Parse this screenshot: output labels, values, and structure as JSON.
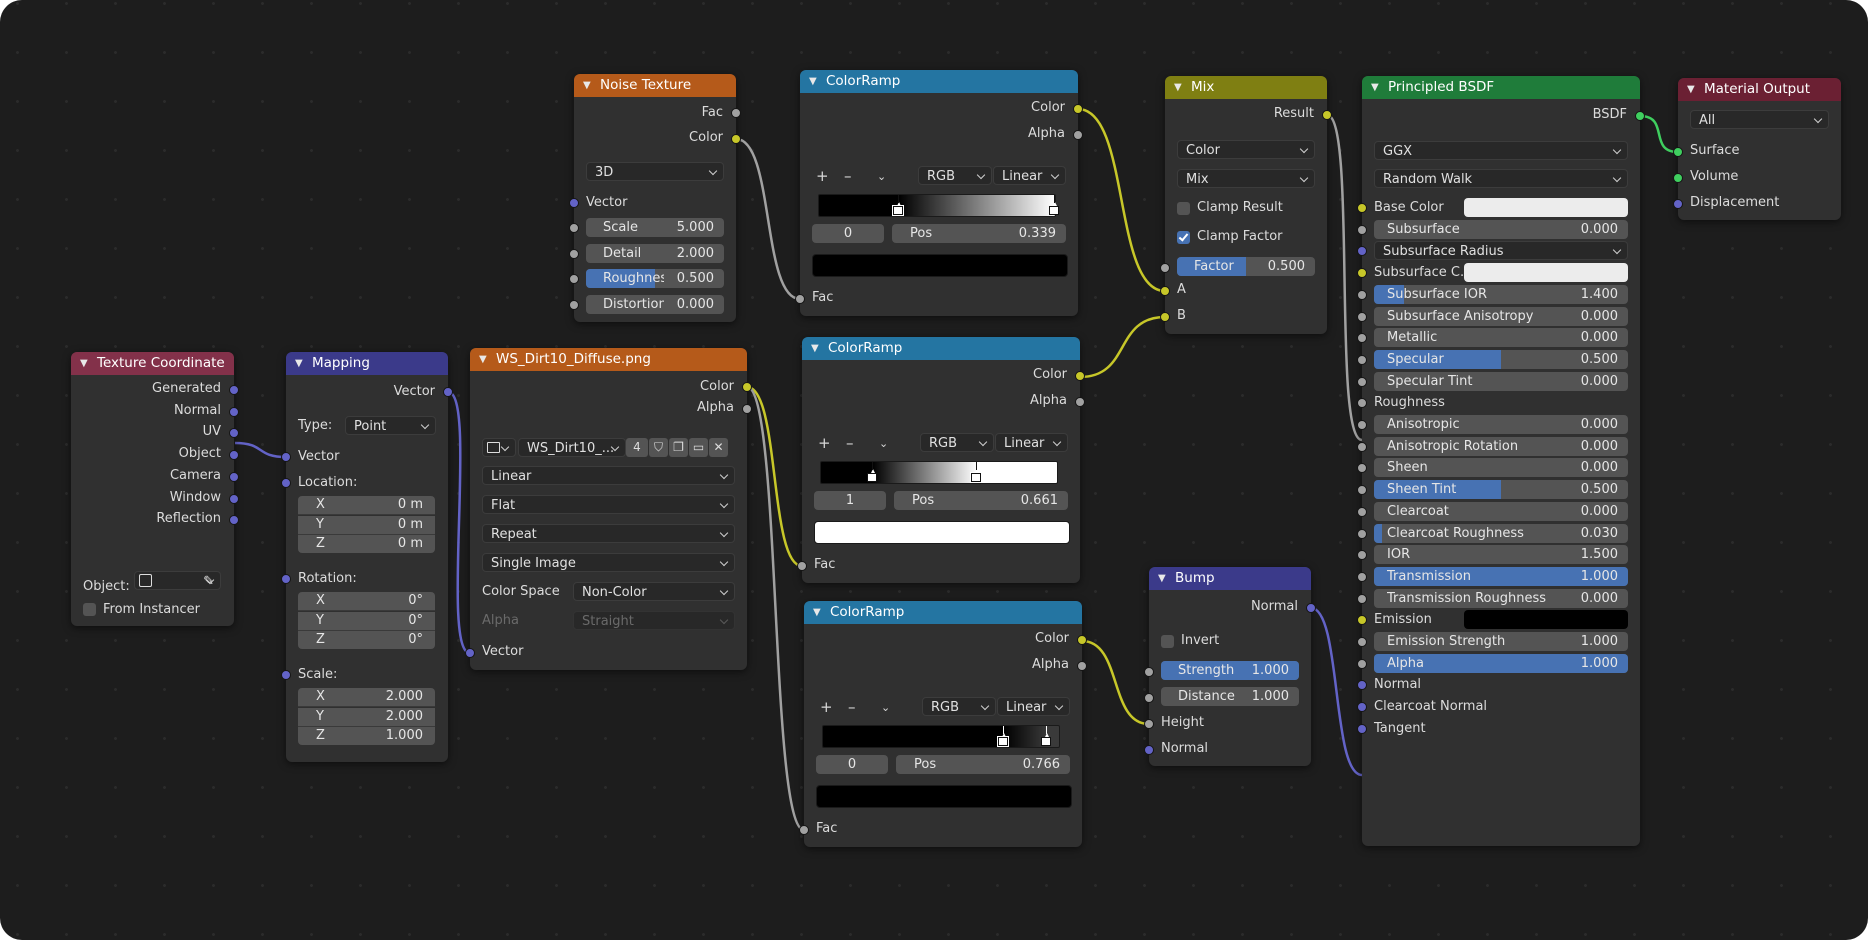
{
  "colors": {
    "bg": "#1d1d1d",
    "node": "#303030",
    "accent": "#4772b3",
    "socket_color": "#c7c729",
    "socket_float": "#a1a1a1",
    "socket_vector": "#6363c7",
    "socket_shader": "#3fcf5f"
  },
  "tex_coord": {
    "title": "Texture Coordinate",
    "outputs": [
      "Generated",
      "Normal",
      "UV",
      "Object",
      "Camera",
      "Window",
      "Reflection"
    ],
    "object_label": "Object:",
    "from_instancer": "From Instancer"
  },
  "mapping": {
    "title": "Mapping",
    "out_vector": "Vector",
    "type_label": "Type:",
    "type_value": "Point",
    "in_vector": "Vector",
    "location": "Location:",
    "rotation": "Rotation:",
    "scale": "Scale:",
    "loc": [
      {
        "axis": "X",
        "value": "0 m"
      },
      {
        "axis": "Y",
        "value": "0 m"
      },
      {
        "axis": "Z",
        "value": "0 m"
      }
    ],
    "rot": [
      {
        "axis": "X",
        "value": "0°"
      },
      {
        "axis": "Y",
        "value": "0°"
      },
      {
        "axis": "Z",
        "value": "0°"
      }
    ],
    "scl": [
      {
        "axis": "X",
        "value": "2.000"
      },
      {
        "axis": "Y",
        "value": "2.000"
      },
      {
        "axis": "Z",
        "value": "1.000"
      }
    ]
  },
  "image_tex": {
    "title": "WS_Dirt10_Diffuse.png",
    "out_color": "Color",
    "out_alpha": "Alpha",
    "image_name": "WS_Dirt10_...",
    "users": "4",
    "interpolation": "Linear",
    "projection": "Flat",
    "extension": "Repeat",
    "source": "Single Image",
    "color_space_label": "Color Space",
    "color_space": "Non-Color",
    "alpha_label": "Alpha",
    "alpha_mode": "Straight",
    "in_vector": "Vector"
  },
  "noise": {
    "title": "Noise Texture",
    "out_fac": "Fac",
    "out_color": "Color",
    "dimensions": "3D",
    "in_vector": "Vector",
    "fields": [
      {
        "label": "Scale",
        "value": "5.000"
      },
      {
        "label": "Detail",
        "value": "2.000"
      },
      {
        "label": "Roughnes",
        "value": "0.500",
        "fill": 0.5
      },
      {
        "label": "Distortion",
        "value": "0.000"
      }
    ]
  },
  "ramps": [
    {
      "title": "ColorRamp",
      "out_color": "Color",
      "out_alpha": "Alpha",
      "mode": "RGB",
      "interp": "Linear",
      "index": "0",
      "pos_label": "Pos",
      "pos": "0.339",
      "stops": [
        0.339,
        1.0
      ],
      "gradient": [
        "#000000",
        "#000000",
        "#ffffff"
      ],
      "swatch": "#000000",
      "in_fac": "Fac"
    },
    {
      "title": "ColorRamp",
      "out_color": "Color",
      "out_alpha": "Alpha",
      "mode": "RGB",
      "interp": "Linear",
      "index": "1",
      "pos_label": "Pos",
      "pos": "0.661",
      "stops": [
        0.219,
        0.661
      ],
      "gradient": [
        "#000000",
        "#000000",
        "#ffffff",
        "#ffffff"
      ],
      "swatch": "#ffffff",
      "in_fac": "Fac"
    },
    {
      "title": "ColorRamp",
      "out_color": "Color",
      "out_alpha": "Alpha",
      "mode": "RGB",
      "interp": "Linear",
      "index": "0",
      "pos_label": "Pos",
      "pos": "0.766",
      "stops": [
        0.766,
        0.95
      ],
      "gradient": [
        "#000000",
        "#000000",
        "#3a3a3a"
      ],
      "swatch": "#000000",
      "in_fac": "Fac"
    }
  ],
  "mix": {
    "title": "Mix",
    "out_result": "Result",
    "data_type": "Color",
    "blend": "Mix",
    "clamp_result": "Clamp Result",
    "clamp_factor": "Clamp Factor",
    "factor_label": "Factor",
    "factor_value": "0.500",
    "factor": 0.5,
    "in_a": "A",
    "in_b": "B"
  },
  "bump": {
    "title": "Bump",
    "out_normal": "Normal",
    "invert": "Invert",
    "strength_label": "Strength",
    "strength": "1.000",
    "distance_label": "Distance",
    "distance": "1.000",
    "in_height": "Height",
    "in_normal": "Normal"
  },
  "bsdf": {
    "title": "Principled BSDF",
    "out": "BSDF",
    "distribution": "GGX",
    "subsurface_method": "Random Walk",
    "base_color": "Base Color",
    "subsurface_color": "Subsurface C...",
    "subsurface_radius": "Subsurface Radius",
    "roughness": "Roughness",
    "emission": "Emission",
    "normal": "Normal",
    "clearcoat_normal": "Clearcoat Normal",
    "tangent": "Tangent",
    "fields": [
      {
        "label": "Subsurface",
        "value": "0.000",
        "fill": 0
      },
      {
        "label": "Subsurface IOR",
        "value": "1.400",
        "fill": 0.12
      },
      {
        "label": "Subsurface Anisotropy",
        "value": "0.000",
        "fill": 0
      },
      {
        "label": "Metallic",
        "value": "0.000",
        "fill": 0
      },
      {
        "label": "Specular",
        "value": "0.500",
        "fill": 0.5
      },
      {
        "label": "Specular Tint",
        "value": "0.000",
        "fill": 0
      },
      {
        "label": "Anisotropic",
        "value": "0.000",
        "fill": 0
      },
      {
        "label": "Anisotropic Rotation",
        "value": "0.000",
        "fill": 0
      },
      {
        "label": "Sheen",
        "value": "0.000",
        "fill": 0
      },
      {
        "label": "Sheen Tint",
        "value": "0.500",
        "fill": 0.5
      },
      {
        "label": "Clearcoat",
        "value": "0.000",
        "fill": 0
      },
      {
        "label": "Clearcoat Roughness",
        "value": "0.030",
        "fill": 0.03
      },
      {
        "label": "IOR",
        "value": "1.500",
        "fill": 0
      },
      {
        "label": "Transmission",
        "value": "1.000",
        "fill": 1
      },
      {
        "label": "Transmission Roughness",
        "value": "0.000",
        "fill": 0
      },
      {
        "label": "Emission Strength",
        "value": "1.000",
        "fill": 0
      },
      {
        "label": "Alpha",
        "value": "1.000",
        "fill": 1
      }
    ]
  },
  "output": {
    "title": "Material Output",
    "target": "All",
    "surface": "Surface",
    "volume": "Volume",
    "displacement": "Displacement"
  }
}
